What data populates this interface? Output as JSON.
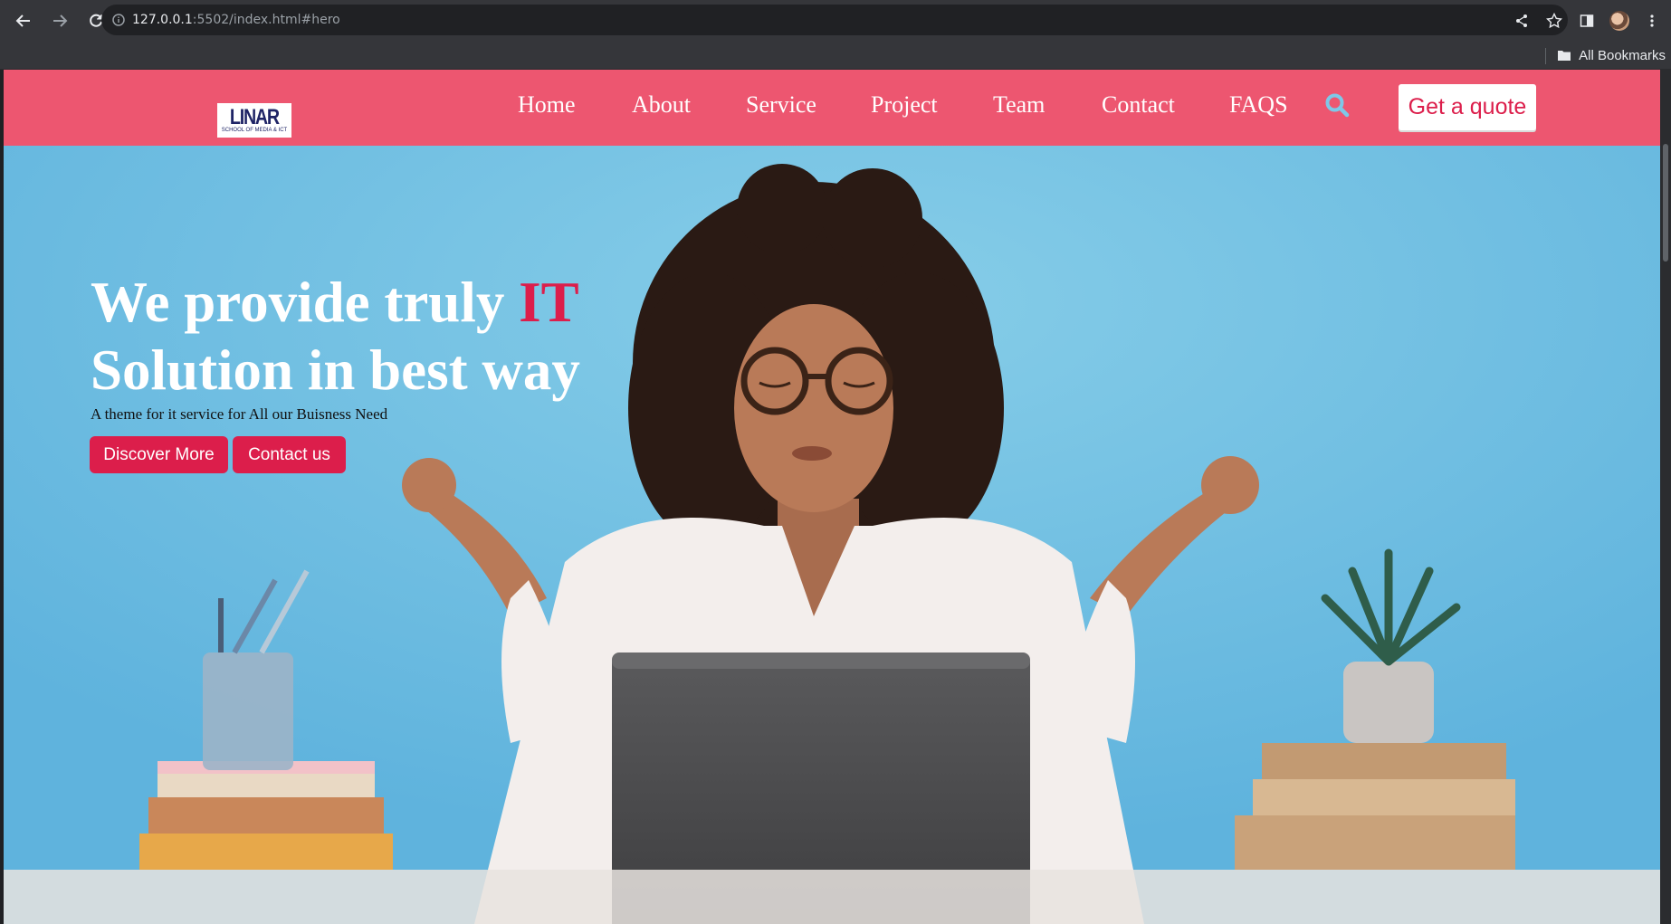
{
  "browser": {
    "url_host": "127.0.0.1",
    "url_rest": ":5502/index.html#hero",
    "bookmarks_label": "All Bookmarks"
  },
  "header": {
    "logo_main": "LINAR",
    "logo_sub": "SCHOOL OF MEDIA & ICT",
    "nav": [
      "Home",
      "About",
      "Service",
      "Project",
      "Team",
      "Contact",
      "FAQS"
    ],
    "quote_label": "Get a quote"
  },
  "hero": {
    "title_part1": "We provide truly ",
    "title_highlight": "IT",
    "title_part2": "Solution in best way",
    "subtitle": "A theme for it service for All our Buisness Need",
    "btn_discover": "Discover More",
    "btn_contact": "Contact us"
  },
  "colors": {
    "header_bg": "#ed5670",
    "accent": "#dc1e4b",
    "hero_bg": "#78c2e0",
    "logo_text": "#1f2466"
  }
}
